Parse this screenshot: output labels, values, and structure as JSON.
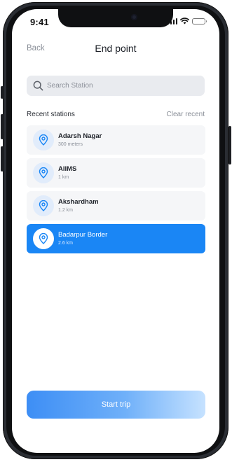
{
  "status_bar": {
    "time": "9:41"
  },
  "nav": {
    "back_label": "Back",
    "title": "End point"
  },
  "search": {
    "placeholder": "Search Station",
    "value": ""
  },
  "recent": {
    "section_title": "Recent stations",
    "clear_label": "Clear recent",
    "items": [
      {
        "name": "Adarsh Nagar",
        "distance": "300 meters",
        "selected": false,
        "icon": "location-pin-icon"
      },
      {
        "name": "AIIMS",
        "distance": "1 km",
        "selected": false,
        "icon": "location-pin-icon"
      },
      {
        "name": "Akshardham",
        "distance": "1.2 km",
        "selected": false,
        "icon": "location-pin-icon"
      },
      {
        "name": "Badarpur Border",
        "distance": "2.6 km",
        "selected": true,
        "icon": "location-pin-icon"
      }
    ]
  },
  "footer": {
    "start_label": "Start trip"
  },
  "colors": {
    "accent": "#1a86f5",
    "item_bg": "#f5f6f8",
    "search_bg": "#e9ebef"
  }
}
